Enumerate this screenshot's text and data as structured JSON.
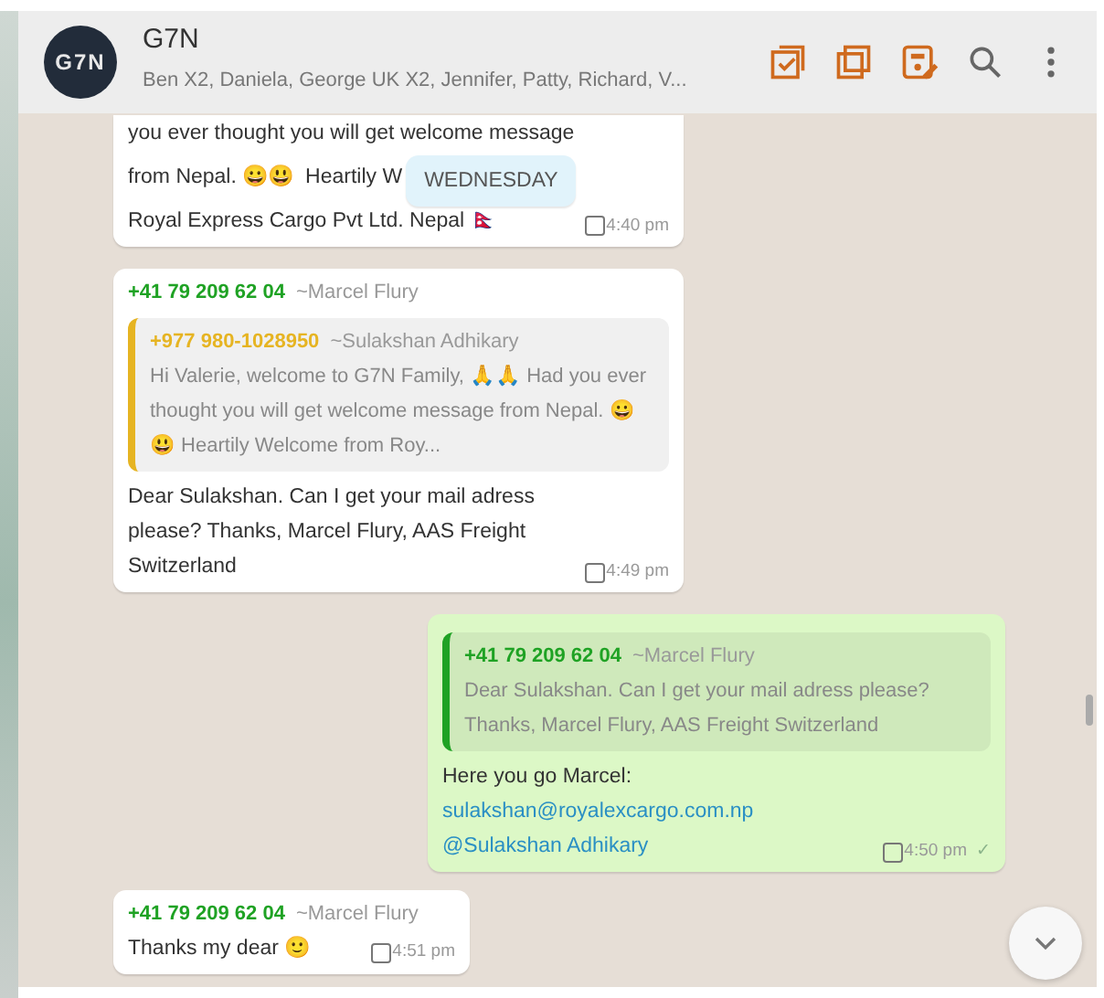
{
  "header": {
    "avatar_text": "G7N",
    "title": "G7N",
    "members": "Ben X2, Daniela, George UK X2, Jennifer, Patty, Richard, V..."
  },
  "date_pill": "WEDNESDAY",
  "messages": [
    {
      "kind": "incoming",
      "lines": [
        "you ever thought you will get welcome message",
        "from Nepal. 😀😃  Heartily W",
        "Royal Express Cargo Pvt Ltd. Nepal 🇳🇵"
      ],
      "time": "4:40 pm"
    },
    {
      "kind": "incoming",
      "sender": {
        "phone": "+41 79 209 62 04",
        "name": "~Marcel Flury"
      },
      "quote": {
        "phone": "+977 980-1028950",
        "name": "~Sulakshan Adhikary",
        "text": "Hi Valerie, welcome to G7N Family, 🙏🙏 Had you ever thought you will get welcome message from Nepal. 😀😃  Heartily Welcome from Roy...",
        "color": "#e6b422"
      },
      "text": "Dear Sulakshan. Can I get your mail adress please? Thanks, Marcel Flury, AAS Freight Switzerland",
      "time": "4:49 pm"
    },
    {
      "kind": "outgoing",
      "quote": {
        "phone": "+41 79 209 62 04",
        "name": "~Marcel Flury",
        "text": "Dear Sulakshan. Can I get your mail adress please? Thanks, Marcel Flury, AAS Freight Switzerland",
        "color": "#1fa224"
      },
      "text": "Here you go Marcel:",
      "link": "sulakshan@royalexcargo.com.np @Sulakshan Adhikary",
      "time": "4:50 pm",
      "tick": "✓"
    },
    {
      "kind": "incoming",
      "sender": {
        "phone": "+41 79 209 62 04",
        "name": "~Marcel Flury"
      },
      "text": "Thanks my dear 🙂",
      "time": "4:51 pm"
    }
  ]
}
